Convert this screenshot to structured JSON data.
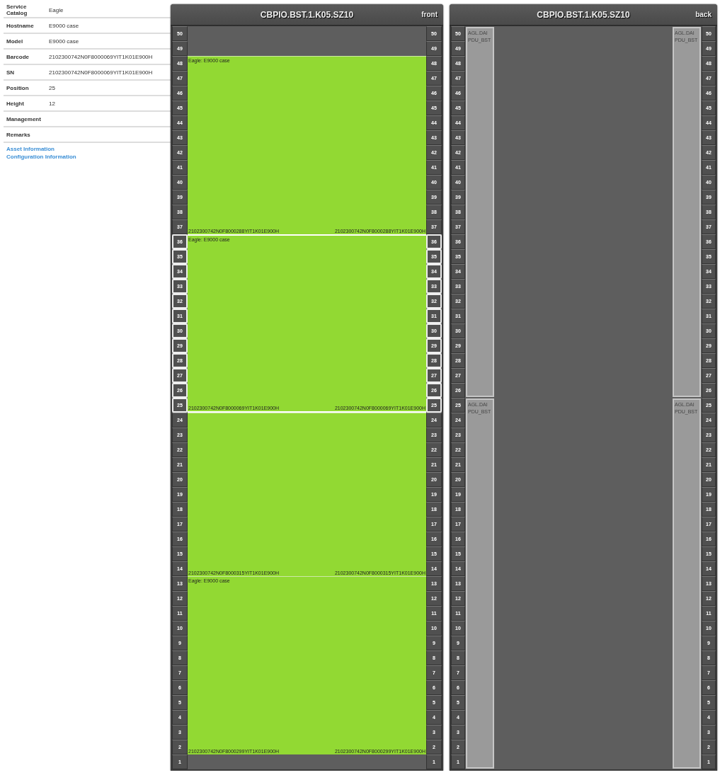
{
  "properties": [
    {
      "label": "Service Catalog",
      "value": "Eagle"
    },
    {
      "label": "Hostname",
      "value": "E9000 case"
    },
    {
      "label": "Model",
      "value": "E9000 case"
    },
    {
      "label": "Barcode",
      "value": "2102300742N0F8000069YIT1K01E900H"
    },
    {
      "label": "SN",
      "value": "2102300742N0F8000069YIT1K01E900H"
    },
    {
      "label": "Position",
      "value": "25"
    },
    {
      "label": "Height",
      "value": "12"
    },
    {
      "label": "Management"
    },
    {
      "label": "Remarks"
    }
  ],
  "links": [
    "Asset Information",
    "Configuration Information"
  ],
  "racks": [
    {
      "title": "CBPIO.BST.1.K05.SZ10",
      "side": "front",
      "blocks": [
        {
          "kind": "empty",
          "units": [
            [
              "50",
              "50"
            ],
            [
              "49",
              "49"
            ]
          ]
        },
        {
          "kind": "device",
          "label": "Eagle: E9000 case",
          "serial_left": "2102300742N0F8000288YIT1K01E900H",
          "serial_right": "2102300742N0F8000288YIT1K01E900H",
          "selected": false,
          "units": [
            [
              "48",
              "48"
            ],
            [
              "47",
              "47"
            ],
            [
              "46",
              "46"
            ],
            [
              "45",
              "45"
            ],
            [
              "44",
              "44"
            ],
            [
              "43",
              "43"
            ],
            [
              "42",
              "42"
            ],
            [
              "41",
              "41"
            ],
            [
              "40",
              "40"
            ],
            [
              "39",
              "39"
            ],
            [
              "38",
              "38"
            ],
            [
              "37",
              "37"
            ]
          ]
        },
        {
          "kind": "device",
          "label": "Eagle: E9000 case",
          "serial_left": "2102300742N0F8000069YIT1K01E900H",
          "serial_right": "2102300742N0F8000069YIT1K01E900H",
          "selected": true,
          "units": [
            [
              "36",
              "36"
            ],
            [
              "35",
              "35"
            ],
            [
              "34",
              "34"
            ],
            [
              "33",
              "33"
            ],
            [
              "32",
              "32"
            ],
            [
              "31",
              "31"
            ],
            [
              "30",
              "30"
            ],
            [
              "29",
              "29"
            ],
            [
              "28",
              "28"
            ],
            [
              "27",
              "27"
            ],
            [
              "26",
              "26"
            ],
            [
              "25",
              "25"
            ]
          ]
        },
        {
          "kind": "device",
          "serial_left": "2102300742N0F8000315YIT1K01E900H",
          "serial_right": "2102300742N0F8000315YIT1K01E900H",
          "selected": false,
          "units": [
            [
              "24",
              "24"
            ],
            [
              "23",
              "23"
            ],
            [
              "22",
              "22"
            ],
            [
              "21",
              "21"
            ],
            [
              "20",
              "20"
            ],
            [
              "19",
              "19"
            ],
            [
              "18",
              "18"
            ],
            [
              "17",
              "17"
            ],
            [
              "16",
              "16"
            ],
            [
              "15",
              "15"
            ],
            [
              "14",
              "14"
            ]
          ]
        },
        {
          "kind": "device",
          "label": "Eagle: E9000 case",
          "serial_left": "2102300742N0F8000299YIT1K01E900H",
          "serial_right": "2102300742N0F8000299YIT1K01E900H",
          "selected": false,
          "units": [
            [
              "13",
              "13"
            ],
            [
              "12",
              "12"
            ],
            [
              "11",
              "11"
            ],
            [
              "10",
              "10"
            ],
            [
              "9",
              "9"
            ],
            [
              "8",
              "8"
            ],
            [
              "7",
              "7"
            ],
            [
              "6",
              "6"
            ],
            [
              "5",
              "5"
            ],
            [
              "4",
              "4"
            ],
            [
              "3",
              "3"
            ],
            [
              "2",
              "2"
            ]
          ]
        },
        {
          "kind": "empty",
          "units": [
            [
              "1",
              "1"
            ]
          ]
        }
      ]
    },
    {
      "title": "CBPIO.BST.1.K05.SZ10",
      "side": "back",
      "blocks": [
        {
          "kind": "pdu_pair",
          "pdus": [
            {
              "line_1": "AGL.DAI",
              "line_2": "PDU_BST"
            },
            {
              "line_1": "AGL.DAI",
              "line_2": "PDU_BST"
            }
          ],
          "units": [
            [
              "50",
              "50"
            ],
            [
              "49",
              "49"
            ],
            [
              "48",
              "48"
            ],
            [
              "47",
              "47"
            ],
            [
              "46",
              "46"
            ],
            [
              "45",
              "45"
            ],
            [
              "44",
              "44"
            ],
            [
              "43",
              "43"
            ],
            [
              "42",
              "42"
            ],
            [
              "41",
              "41"
            ],
            [
              "40",
              "40"
            ],
            [
              "39",
              "39"
            ],
            [
              "38",
              "38"
            ],
            [
              "37",
              "37"
            ],
            [
              "36",
              "36"
            ],
            [
              "35",
              "35"
            ],
            [
              "34",
              "34"
            ],
            [
              "33",
              "33"
            ],
            [
              "32",
              "32"
            ],
            [
              "31",
              "31"
            ],
            [
              "30",
              "30"
            ],
            [
              "29",
              "29"
            ],
            [
              "28",
              "28"
            ],
            [
              "27",
              "27"
            ],
            [
              "26",
              "26"
            ]
          ]
        },
        {
          "kind": "pdu_pair",
          "pdus": [
            {
              "line_1": "AGL.DAI",
              "line_2": "PDU_BST"
            },
            {
              "line_1": "AGL.DAI",
              "line_2": "PDU_BST"
            }
          ],
          "units": [
            [
              "25",
              "25"
            ],
            [
              "24",
              "24"
            ],
            [
              "23",
              "23"
            ],
            [
              "22",
              "22"
            ],
            [
              "21",
              "21"
            ],
            [
              "20",
              "20"
            ],
            [
              "19",
              "19"
            ],
            [
              "18",
              "18"
            ],
            [
              "17",
              "17"
            ],
            [
              "16",
              "16"
            ],
            [
              "15",
              "15"
            ],
            [
              "14",
              "14"
            ],
            [
              "13",
              "13"
            ],
            [
              "12",
              "12"
            ],
            [
              "11",
              "11"
            ],
            [
              "10",
              "10"
            ],
            [
              "9",
              "9"
            ],
            [
              "8",
              "8"
            ],
            [
              "7",
              "7"
            ],
            [
              "6",
              "6"
            ],
            [
              "5",
              "5"
            ],
            [
              "4",
              "4"
            ],
            [
              "3",
              "3"
            ],
            [
              "2",
              "2"
            ],
            [
              "1",
              "1"
            ]
          ]
        }
      ]
    }
  ]
}
